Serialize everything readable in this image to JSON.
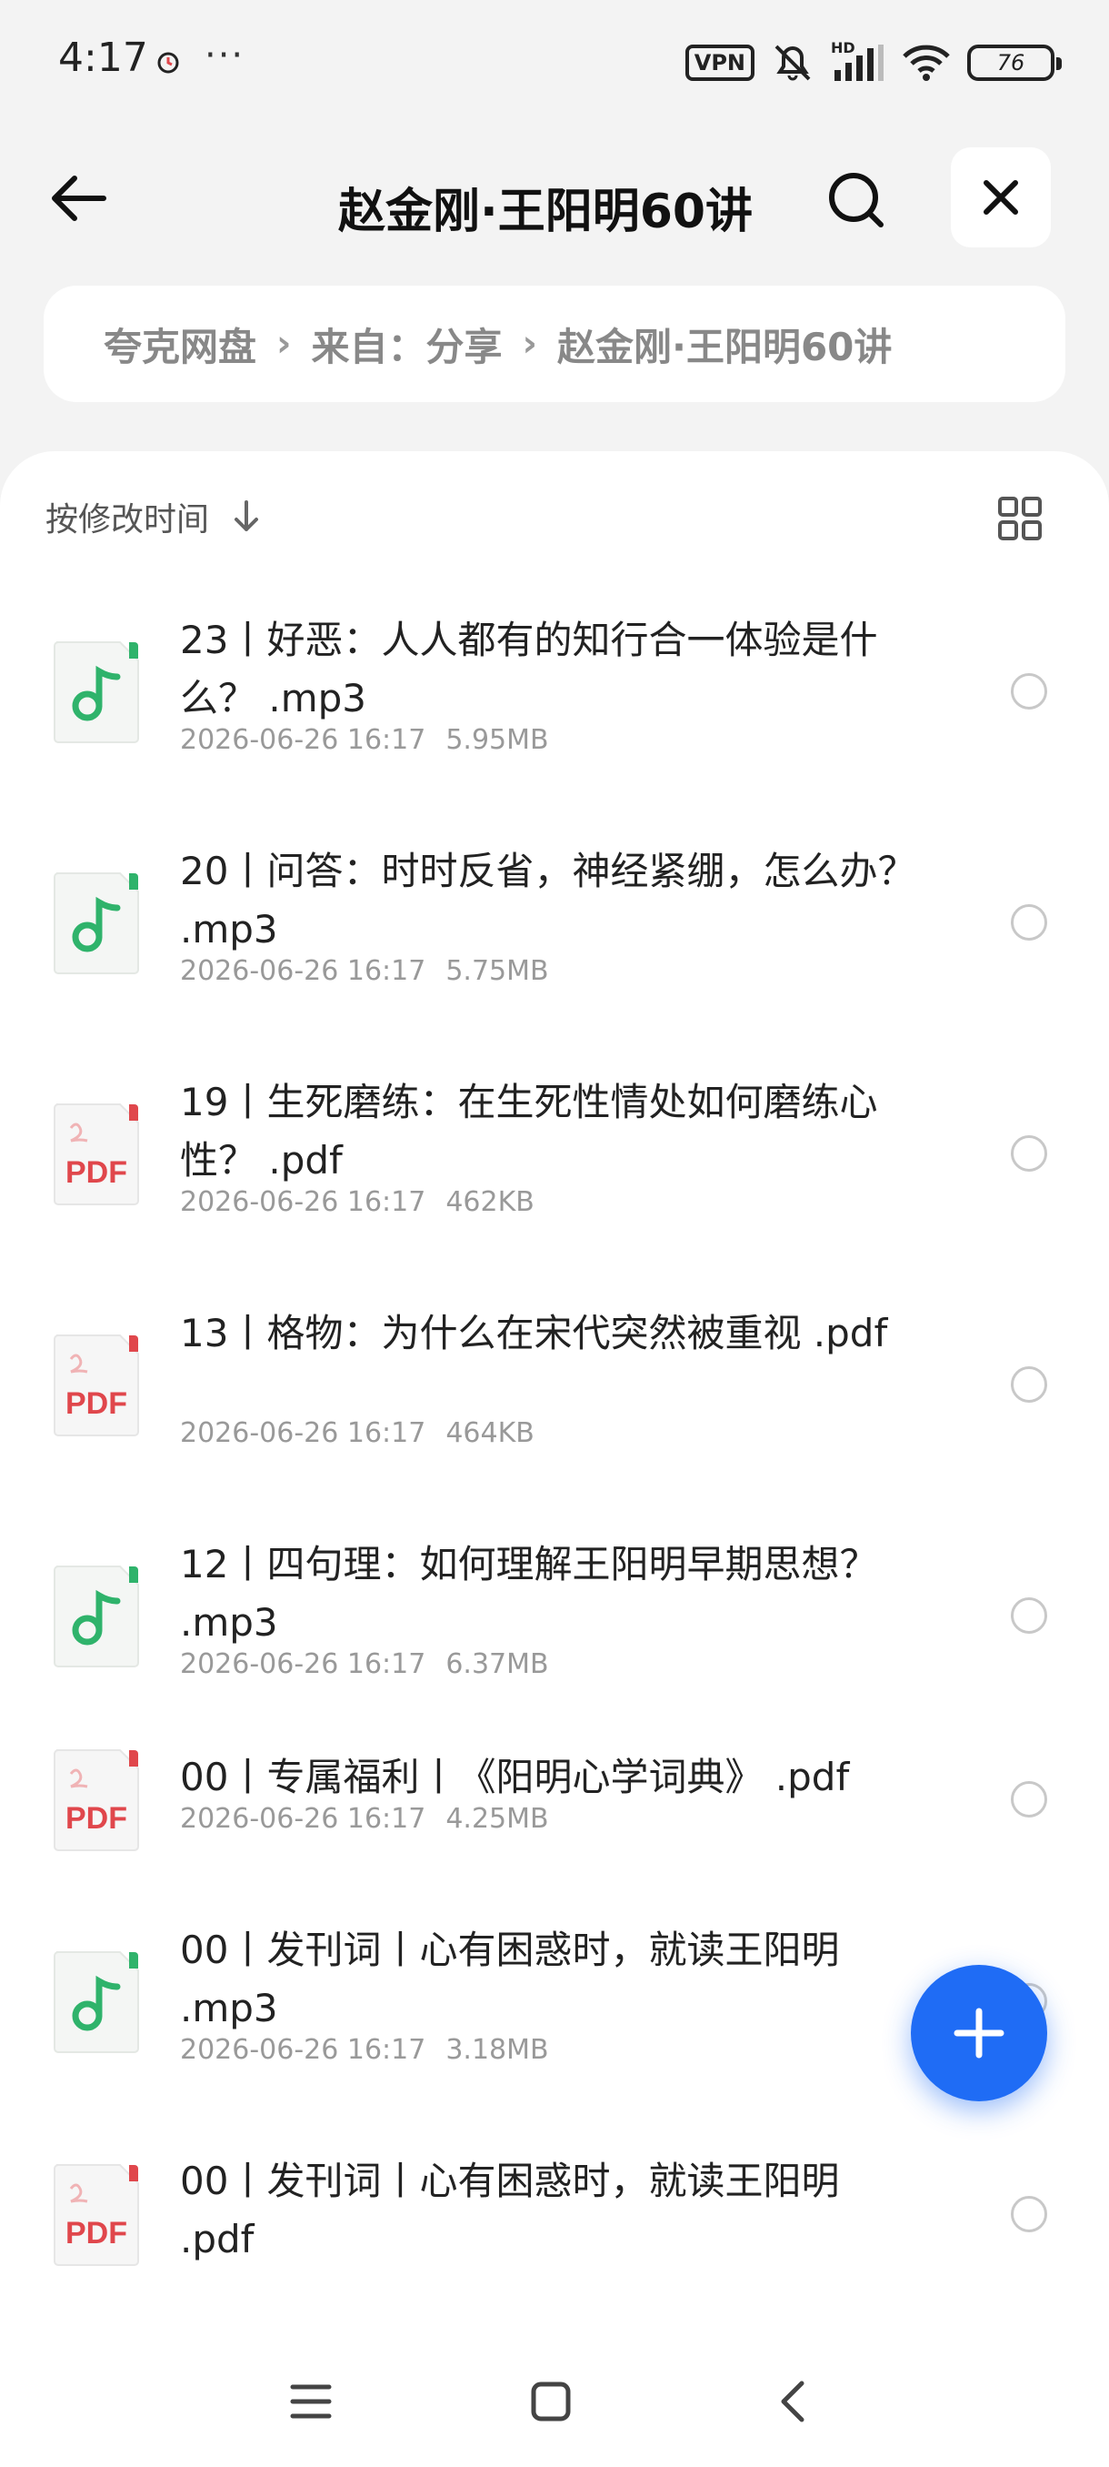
{
  "status_bar": {
    "time": "4:17",
    "more": "···",
    "vpn": "VPN",
    "hd": "HD",
    "battery": "76"
  },
  "header": {
    "title": "赵金刚·王阳明60讲"
  },
  "breadcrumb": {
    "items": [
      "夸克网盘",
      "来自：分享",
      "赵金刚·王阳明60讲"
    ],
    "separator": "›"
  },
  "toolbar": {
    "sort_label": "按修改时间"
  },
  "files": [
    {
      "title": "23丨好恶：人人都有的知行合一体验是什么？ .mp3",
      "date": "2026-06-26 16:17",
      "size": "5.95MB",
      "type": "mp3"
    },
    {
      "title": "20丨问答：时时反省，神经紧绷，怎么办？ .mp3",
      "date": "2026-06-26 16:17",
      "size": "5.75MB",
      "type": "mp3"
    },
    {
      "title": "19丨生死磨练：在生死性情处如何磨练心性？ .pdf",
      "date": "2026-06-26 16:17",
      "size": "462KB",
      "type": "pdf"
    },
    {
      "title": "13丨格物：为什么在宋代突然被重视 .pdf",
      "date": "2026-06-26 16:17",
      "size": "464KB",
      "type": "pdf"
    },
    {
      "title": "12丨四句理：如何理解王阳明早期思想？ .mp3",
      "date": "2026-06-26 16:17",
      "size": "6.37MB",
      "type": "mp3"
    },
    {
      "title": "00丨专属福利丨《阳明心学词典》 .pdf",
      "date": "2026-06-26 16:17",
      "size": "4.25MB",
      "type": "pdf"
    },
    {
      "title": "00丨发刊词丨心有困惑时，就读王阳明 .mp3",
      "date": "2026-06-26 16:17",
      "size": "3.18MB",
      "type": "mp3"
    },
    {
      "title": "00丨发刊词丨心有困惑时，就读王阳明 .pdf",
      "date": "",
      "size": "",
      "type": "pdf"
    }
  ],
  "icons": {
    "pdf_label": "PDF"
  },
  "colors": {
    "accent": "#1f6cf5",
    "audio_icon": "#2fb36b",
    "pdf_icon": "#e0474c"
  }
}
